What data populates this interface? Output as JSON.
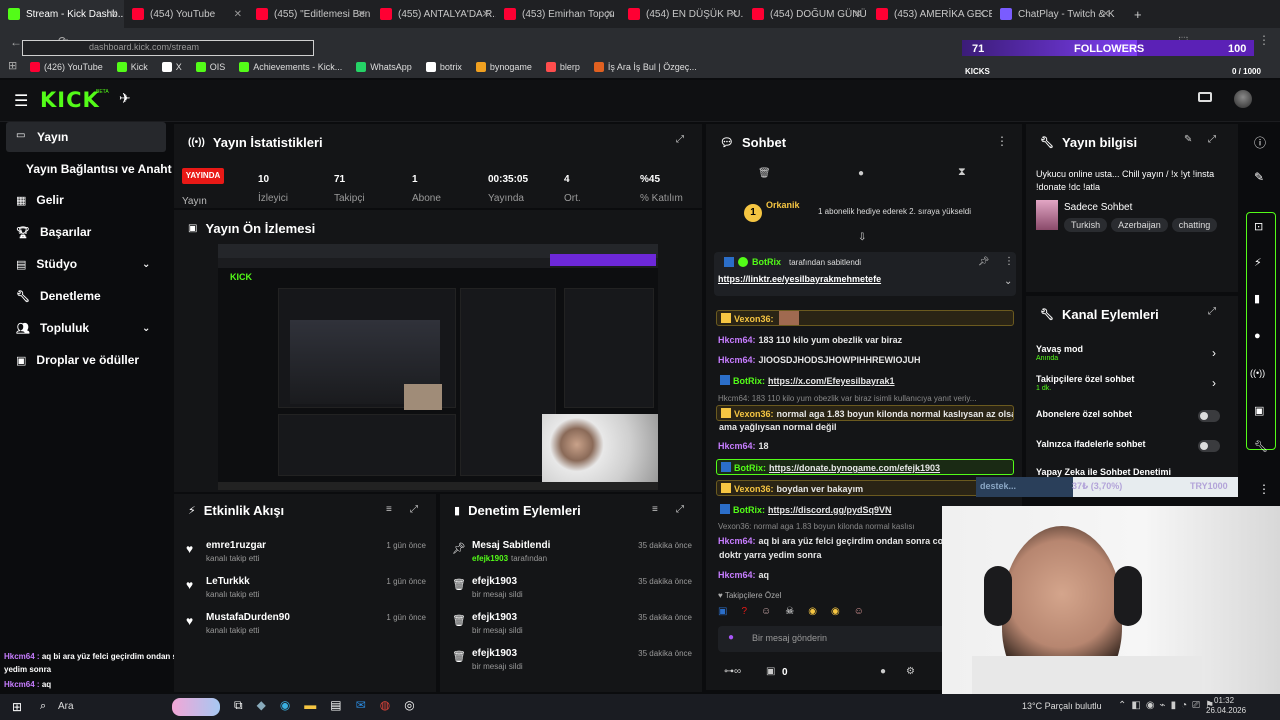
{
  "browser": {
    "tabs": [
      {
        "label": "Stream - Kick Dashb...",
        "color": "#53fc18",
        "active": true
      },
      {
        "label": "(454) YouTube",
        "color": "#ff0033"
      },
      {
        "label": "(455) \"Editlemesi Ben",
        "color": "#ff0033"
      },
      {
        "label": "(455) ANTALYA'DA R...",
        "color": "#ff0033"
      },
      {
        "label": "(453) Emirhan Topçu",
        "color": "#ff0033"
      },
      {
        "label": "(454) EN DÜŞÜK PU...",
        "color": "#ff0033"
      },
      {
        "label": "(454) DOĞUM GÜNÜ",
        "color": "#ff0033"
      },
      {
        "label": "(453) AMERİKA GECE",
        "color": "#ff0033"
      },
      {
        "label": "ChatPlay - Twitch & K",
        "color": "#7a5cff"
      }
    ],
    "url": "dashboard.kick.com/stream",
    "bookmarks": [
      {
        "label": "(426) YouTube",
        "color": "#ff0033"
      },
      {
        "label": "Kick",
        "color": "#53fc18"
      },
      {
        "label": "X",
        "color": "#ffffff"
      },
      {
        "label": "OIS",
        "color": "#53fc18"
      },
      {
        "label": "Achievements - Kick...",
        "color": "#53fc18"
      },
      {
        "label": "WhatsApp",
        "color": "#25d366"
      },
      {
        "label": "botrix",
        "color": "#ffffff"
      },
      {
        "label": "bynogame",
        "color": "#f0a020"
      },
      {
        "label": "blerp",
        "color": "#ff4d4d"
      },
      {
        "label": "İş Ara İş Bul | Özgeç...",
        "color": "#e06020"
      }
    ]
  },
  "overlay": {
    "followers_count": "71",
    "followers_label": "FOLLOWERS",
    "followers_goal": "100",
    "kicks_label": "KICKS",
    "kicks_progress": "0 / 1000",
    "donate_text": "destek...",
    "donate_percent": "37₺ (3,70%)",
    "donate_goal": "TRY1000"
  },
  "sidebar": {
    "items": [
      {
        "label": "Yayın",
        "active": true
      },
      {
        "label": "Yayın Bağlantısı ve Anahtarı"
      },
      {
        "label": "Gelir"
      },
      {
        "label": "Başarılar"
      },
      {
        "label": "Stüdyo"
      },
      {
        "label": "Denetleme"
      },
      {
        "label": "Topluluk"
      },
      {
        "label": "Droplar ve ödüller"
      }
    ]
  },
  "stats": {
    "title": "Yayın İstatistikleri",
    "live_badge": "YAYINDA",
    "live_label": "Yayın",
    "items": [
      {
        "value": "10",
        "label": "İzleyici"
      },
      {
        "value": "71",
        "label": "Takipçi"
      },
      {
        "value": "1",
        "label": "Abone"
      },
      {
        "value": "00:35:05",
        "label": "Yayında"
      },
      {
        "value": "4",
        "label": "Ort."
      },
      {
        "value": "%45",
        "label": "% Katılım"
      }
    ]
  },
  "preview": {
    "title": "Yayın Ön İzlemesi"
  },
  "activity": {
    "title": "Etkinlik Akışı",
    "rows": [
      {
        "name": "emre1ruzgar",
        "sub": "kanalı takip etti",
        "time": "1 gün önce"
      },
      {
        "name": "LeTurkkk",
        "sub": "kanalı takip etti",
        "time": "1 gün önce"
      },
      {
        "name": "MustafaDurden90",
        "sub": "kanalı takip etti",
        "time": "1 gün önce"
      }
    ]
  },
  "moderation": {
    "title": "Denetim Eylemleri",
    "rows": [
      {
        "name": "Mesaj Sabitlendi",
        "sub_user": "efejk1903",
        "sub": "tarafından",
        "time": "35 dakika önce"
      },
      {
        "name": "efejk1903",
        "sub": "bir mesajı sildi",
        "time": "35 dakika önce"
      },
      {
        "name": "efejk1903",
        "sub": "bir mesajı sildi",
        "time": "35 dakika önce"
      },
      {
        "name": "efejk1903",
        "sub": "bir mesajı sildi",
        "time": "35 dakika önce"
      }
    ]
  },
  "chat": {
    "title": "Sohbet",
    "gift_user": "Orkanik",
    "gift_badge": "1",
    "gift_text": "1 abonelik hediye ederek 2. sıraya yükseldi",
    "pinned_user": "BotRix",
    "pinned_by": "tarafından sabitlendi",
    "pinned_link": "https://linktr.ee/yesilbayrakmehmetefe",
    "messages": [
      {
        "user": "Vexon36:",
        "text": "",
        "color": "#f5c542",
        "hl": true
      },
      {
        "user": "Hkcm64:",
        "text": "183 110 kilo yum obezlik var biraz",
        "color": "#c77dff"
      },
      {
        "user": "Hkcm64:",
        "text": "JIOOSDJHODSJHOWPIHHREWIOJUH",
        "color": "#c77dff"
      },
      {
        "user": "BotRix:",
        "text": "https://x.com/Efeyesilbayrak1",
        "color": "#53fc18",
        "link": true
      },
      {
        "user": "Vexon36:",
        "text": "normal aga 1.83 boyun kilonda normal kaslıysan az olsa",
        "color": "#f5c542",
        "hl": true
      },
      {
        "user": "",
        "text": "ama yağlıysan normal değil",
        "color": "#ffffff"
      },
      {
        "user": "Hkcm64:",
        "text": "18",
        "color": "#c77dff"
      },
      {
        "user": "BotRix:",
        "text": "https://donate.bynogame.com/efejk1903",
        "color": "#53fc18",
        "link": true,
        "hlg": true
      },
      {
        "user": "Vexon36:",
        "text": "boydan ver bakayım",
        "color": "#f5c542",
        "hl": true
      },
      {
        "user": "BotRix:",
        "text": "https://discord.gg/pydSq9VN",
        "color": "#53fc18",
        "link": true
      },
      {
        "user": "Hkcm64:",
        "text": "aq bi ara yüz felci geçirdim ondan sonra cort",
        "color": "#c77dff"
      },
      {
        "user": "",
        "text": "doktr yarra yedim sonra",
        "color": "#ffffff"
      },
      {
        "user": "Hkcm64:",
        "text": "aq",
        "color": "#c77dff"
      }
    ],
    "reply1": "Hkcm64: 183 110 kilo yum obezlik var biraz isimli kullanıcıya yanıt veriy...",
    "reply2": "Vexon36: normal aga 1.83 boyun kilonda normal kaslısı",
    "followers_only": "Takipçilere Özel",
    "input_placeholder": "Bir mesaj gönderin",
    "count": "0"
  },
  "info": {
    "title": "Yayın bilgisi",
    "stream_title": "Uykucu online usta... Chill yayın / !x !yt !insta !donate !dc !atla",
    "category": "Sadece Sohbet",
    "tags": [
      "Turkish",
      "Azerbaijan",
      "chatting"
    ]
  },
  "channel_actions": {
    "title": "Kanal Eylemleri",
    "items": [
      {
        "label": "Yavaş mod",
        "sub": "Anında",
        "type": "chevron"
      },
      {
        "label": "Takipçilere özel sohbet",
        "sub": "1 dk.",
        "type": "chevron"
      },
      {
        "label": "Abonelere özel sohbet",
        "sub": "",
        "type": "toggle"
      },
      {
        "label": "Yalnızca ifadelerle sohbet",
        "sub": "",
        "type": "toggle"
      },
      {
        "label": "Yapay Zeka ile Sohbet Denetimi",
        "sub": "",
        "type": "none"
      }
    ]
  },
  "overlay_chat": [
    {
      "user": "Hkcm64 :",
      "text": "aq bi ara yüz felci geçirdim ondan sonra cortizonlu ilaç verdi doktr yarra"
    },
    {
      "user": "",
      "text": "yedim sonra"
    },
    {
      "user": "Hkcm64 :",
      "text": "aq"
    }
  ],
  "taskbar": {
    "search": "Ara",
    "weather": "13°C  Parçalı bulutlu",
    "time": "01:32",
    "date": "26.04.2026"
  },
  "colors": {
    "kick_green": "#53fc18",
    "live_red": "#e91916",
    "followers_purple": "#9b30ff"
  }
}
